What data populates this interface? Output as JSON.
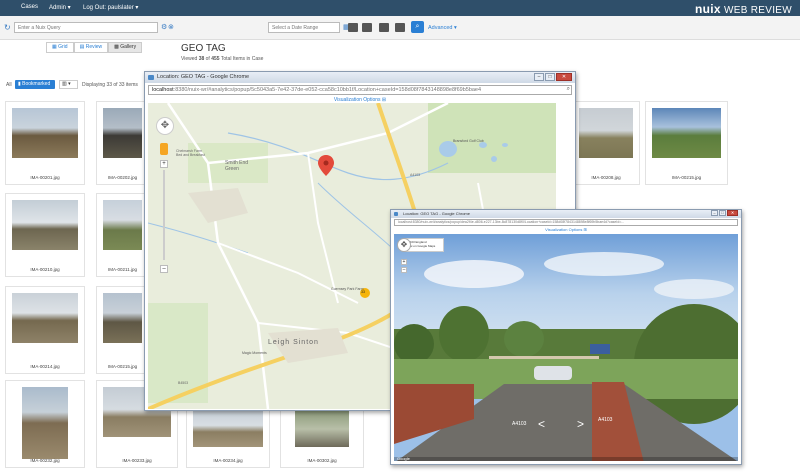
{
  "topnav": {
    "cases": "Cases",
    "admin": "Admin ▾",
    "logout": "Log Out: paulslater ▾",
    "brand_bold": "nuix",
    "brand_rest": "WEB REVIEW"
  },
  "toolbar": {
    "query_placeholder": "Enter a Nuix Query",
    "date_placeholder": "Select a Date Range",
    "advanced": "Advanced ▾"
  },
  "view": {
    "grid": "Grid",
    "review": "Review",
    "gallery": "Gallery",
    "title": "GEO TAG",
    "sub_prefix": "Viewed",
    "viewed": "38",
    "sub_of": "of",
    "total": "455",
    "sub_suffix": "Total Items in Case"
  },
  "filters": {
    "all": "All",
    "bookmarked": "Bookmarked",
    "displaying": "Displaying 33 of 33 items"
  },
  "thumbs": [
    {
      "label": "IMA-00201.jpg"
    },
    {
      "label": "IMA-00202.jpg"
    },
    {
      "label": "IMA-00208.jpg"
    },
    {
      "label": "IMA-00215.jpg"
    },
    {
      "label": "IMA-00210.jpg"
    },
    {
      "label": "IMA-00211.jpg"
    },
    {
      "label": "IMA-00214.jpg"
    },
    {
      "label": "IMA-00215.jpg"
    },
    {
      "label": "IMA-00232.jpg"
    },
    {
      "label": "IMA-00233.jpg"
    },
    {
      "label": "IMA-00234.jpg"
    },
    {
      "label": "IMA-00302.jpg"
    }
  ],
  "map_window": {
    "title": "Location: GEO TAG - Google Chrome",
    "addr_host": "localhost",
    "addr_rest": ":8380/nuix-wr/#analytics/popup/5c5043a5-7e42-37de-e052-cca58c10bb1f/Location+caseId=158d08f7843148898e8f69b5bae4",
    "vis_options": "Visualization Options ⊞",
    "places": {
      "smith_end": "Smith End\nGreen",
      "leigh_sinton": "Leigh Sinton",
      "chelmarsh": "Chelmarsh Farm\nBed and Breakfast",
      "guernsey": "Guernsey Park Farm",
      "magic": "Magic Moments",
      "golf": "Bransford Golf Club",
      "road_a4103": "A4103",
      "road_b4503": "B4503",
      "badge_b": "33"
    }
  },
  "sv_window": {
    "title": "Location: GEO TAG - Google Chrome",
    "addr": "localhost:8380/nuix-wr/#analytics/popup/dea2f4e-d806-e227-13be-8c878130d8f0/Location+caseId=158d08f7843148898e8f69b5bae4d?caseId=...",
    "vis_options": "Visualization Options ⊞",
    "addr_card": "A4103 England\nView on Google Maps",
    "road": "A4103",
    "google": "Google"
  }
}
